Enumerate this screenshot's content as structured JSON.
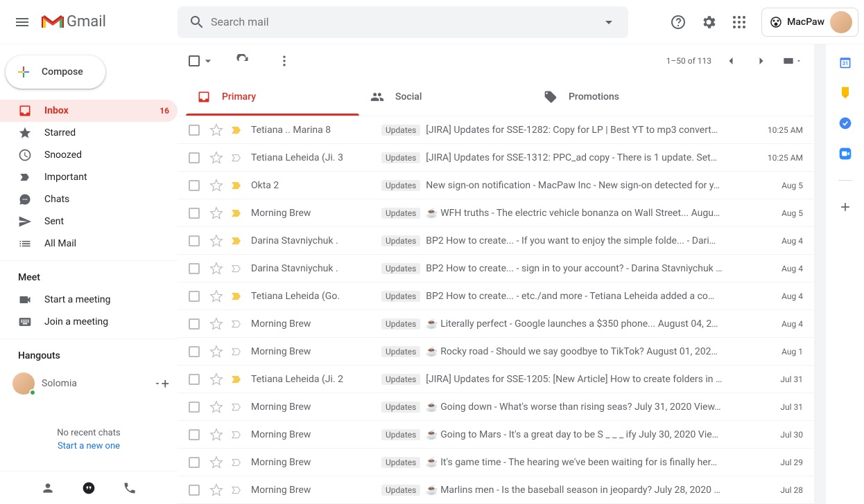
{
  "header": {
    "logo_text": "Gmail",
    "search_placeholder": "Search mail",
    "macpaw_label": "MacPaw"
  },
  "sidebar": {
    "compose_label": "Compose",
    "items": [
      {
        "label": "Inbox",
        "count": "16"
      },
      {
        "label": "Starred"
      },
      {
        "label": "Snoozed"
      },
      {
        "label": "Important"
      },
      {
        "label": "Chats"
      },
      {
        "label": "Sent"
      },
      {
        "label": "All Mail"
      }
    ],
    "meet_label": "Meet",
    "start_meeting": "Start a meeting",
    "join_meeting": "Join a meeting",
    "hangouts_label": "Hangouts",
    "hangouts_user": "Solomia",
    "no_chats": "No recent chats",
    "start_new": "Start a new one"
  },
  "toolbar": {
    "range": "1–50 of 113"
  },
  "tabs": [
    {
      "label": "Primary"
    },
    {
      "label": "Social"
    },
    {
      "label": "Promotions"
    }
  ],
  "emails": [
    {
      "sender": "Tetiana .. Marina",
      "count": "8",
      "imp": true,
      "label": "Updates",
      "emoji": "",
      "subject": "[JIRA] Updates for SSE-1282: Copy for LP | Best YT to mp3 convert…",
      "date": "10:25 AM"
    },
    {
      "sender": "Tetiana Leheida (Ji.",
      "count": "3",
      "imp": false,
      "label": "Updates",
      "emoji": "",
      "subject": "[JIRA] Updates for SSE-1312: PPC_ad copy",
      "snippet": " - There is 1 update. Set…",
      "date": "10:25 AM"
    },
    {
      "sender": "Okta",
      "count": "2",
      "imp": true,
      "label": "Updates",
      "emoji": "",
      "subject": "New sign-on notification",
      "snippet": " - MacPaw Inc - New sign-on detected for y…",
      "date": "Aug 5"
    },
    {
      "sender": "Morning Brew",
      "count": "",
      "imp": true,
      "label": "Updates",
      "emoji": "☕",
      "subject": "WFH truths",
      "snippet": " - The electric vehicle bonanza on Wall Street... Augu…",
      "date": "Aug 5"
    },
    {
      "sender": "Darina Stavniychuk .",
      "count": "",
      "imp": true,
      "label": "Updates",
      "emoji": "",
      "subject": "BP2 How to create...",
      "snippet": " - If you want to enjoy the simple folde... - Dari…",
      "date": "Aug 4"
    },
    {
      "sender": "Darina Stavniychuk .",
      "count": "",
      "imp": false,
      "label": "Updates",
      "emoji": "",
      "subject": "BP2 How to create...",
      "snippet": " - sign in to your account? - Darina Stavniychuk …",
      "date": "Aug 4"
    },
    {
      "sender": "Tetiana Leheida (Go.",
      "count": "",
      "imp": true,
      "label": "Updates",
      "emoji": "",
      "subject": "BP2 How to create...",
      "snippet": " - etc./and more - Tetiana Leheida added a co…",
      "date": "Aug 4"
    },
    {
      "sender": "Morning Brew",
      "count": "",
      "imp": false,
      "label": "Updates",
      "emoji": "☕",
      "subject": "Literally perfect",
      "snippet": " - Google launches a $350 phone... August 04, 2…",
      "date": "Aug 4"
    },
    {
      "sender": "Morning Brew",
      "count": "",
      "imp": false,
      "label": "Updates",
      "emoji": "☕",
      "subject": "Rocky road",
      "snippet": " - Should we say goodbye to TikTok? August 01, 202…",
      "date": "Aug 1"
    },
    {
      "sender": "Tetiana Leheida (Ji.",
      "count": "2",
      "imp": true,
      "label": "Updates",
      "emoji": "",
      "subject": "[JIRA] Updates for SSE-1205: [New Article] How to create folders in …",
      "date": "Jul 31"
    },
    {
      "sender": "Morning Brew",
      "count": "",
      "imp": false,
      "label": "Updates",
      "emoji": "☕",
      "subject": "Going down",
      "snippet": " - What's worse than rising seas? July 31, 2020 View…",
      "date": "Jul 31"
    },
    {
      "sender": "Morning Brew",
      "count": "",
      "imp": false,
      "label": "Updates",
      "emoji": "☕",
      "subject": "Going to Mars",
      "snippet": " - It's a great day to be S _ _ _ ify July 30, 2020 Vie…",
      "date": "Jul 30"
    },
    {
      "sender": "Morning Brew",
      "count": "",
      "imp": false,
      "label": "Updates",
      "emoji": "☕",
      "subject": "It's game time",
      "snippet": " - The hearing we've been waiting for is finally her…",
      "date": "Jul 29"
    },
    {
      "sender": "Morning Brew",
      "count": "",
      "imp": false,
      "label": "Updates",
      "emoji": "☕",
      "subject": "Marlins men",
      "snippet": " - Is the baseball season in jeopardy? July 28, 2020 …",
      "date": "Jul 28"
    }
  ]
}
